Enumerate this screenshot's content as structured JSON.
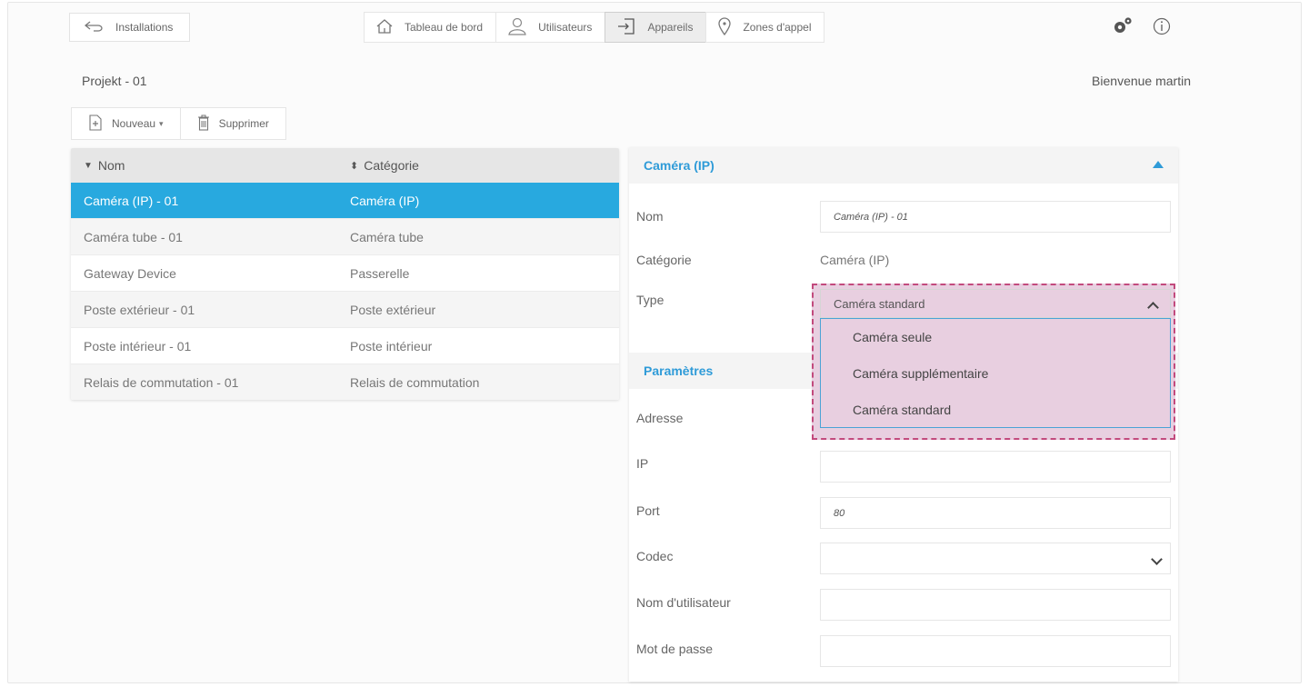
{
  "nav": {
    "back_label": "Installations",
    "tabs": [
      {
        "label": "Tableau de bord",
        "icon": "home-icon"
      },
      {
        "label": "Utilisateurs",
        "icon": "user-icon"
      },
      {
        "label": "Appareils",
        "icon": "device-login-icon",
        "active": true
      },
      {
        "label": "Zones d'appel",
        "icon": "location-pin-icon"
      }
    ],
    "settings_icon": "gear-icon",
    "info_icon": "info-icon"
  },
  "header": {
    "project": "Projekt - 01",
    "welcome": "Bienvenue martin"
  },
  "toolbar": {
    "new_label": "Nouveau",
    "delete_label": "Supprimer"
  },
  "table": {
    "columns": [
      "Nom",
      "Catégorie"
    ],
    "rows": [
      {
        "name": "Caméra (IP) - 01",
        "category": "Caméra (IP)",
        "selected": true
      },
      {
        "name": "Caméra tube - 01",
        "category": "Caméra tube"
      },
      {
        "name": "Gateway Device",
        "category": "Passerelle"
      },
      {
        "name": "Poste extérieur - 01",
        "category": "Poste extérieur"
      },
      {
        "name": "Poste intérieur - 01",
        "category": "Poste intérieur"
      },
      {
        "name": "Relais de commutation - 01",
        "category": "Relais de commutation"
      }
    ]
  },
  "details": {
    "title": "Caméra (IP)",
    "name_label": "Nom",
    "name_value": "Caméra (IP) - 01",
    "category_label": "Catégorie",
    "category_value": "Caméra (IP)",
    "type_label": "Type",
    "type_value": "Caméra standard",
    "type_options": [
      "Caméra seule",
      "Caméra supplémentaire",
      "Caméra standard"
    ]
  },
  "params": {
    "title": "Paramètres",
    "address_label": "Adresse",
    "ip_label": "IP",
    "ip_value": "",
    "port_label": "Port",
    "port_value": "80",
    "codec_label": "Codec",
    "codec_value": "",
    "username_label": "Nom d'utilisateur",
    "username_value": "",
    "password_label": "Mot de passe",
    "password_value": ""
  },
  "colors": {
    "accent": "#2f9bd8",
    "selected_row": "#28a9df",
    "highlight": "#e8cfe0",
    "highlight_border": "#c24a7d"
  }
}
